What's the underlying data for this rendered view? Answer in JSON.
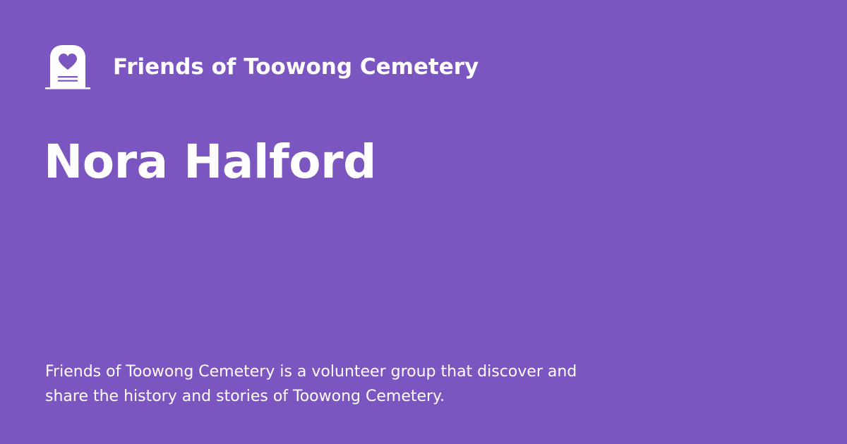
{
  "colors": {
    "background": "#7b55c0",
    "foreground": "#ffffff"
  },
  "logo": {
    "icon": "tombstone-heart-icon"
  },
  "site": {
    "name": "Friends of Toowong Cemetery"
  },
  "page": {
    "title": "Nora Halford"
  },
  "description": {
    "line1": "Friends of Toowong Cemetery is a volunteer group that discover and",
    "line2": "share the history and stories of Toowong Cemetery."
  }
}
